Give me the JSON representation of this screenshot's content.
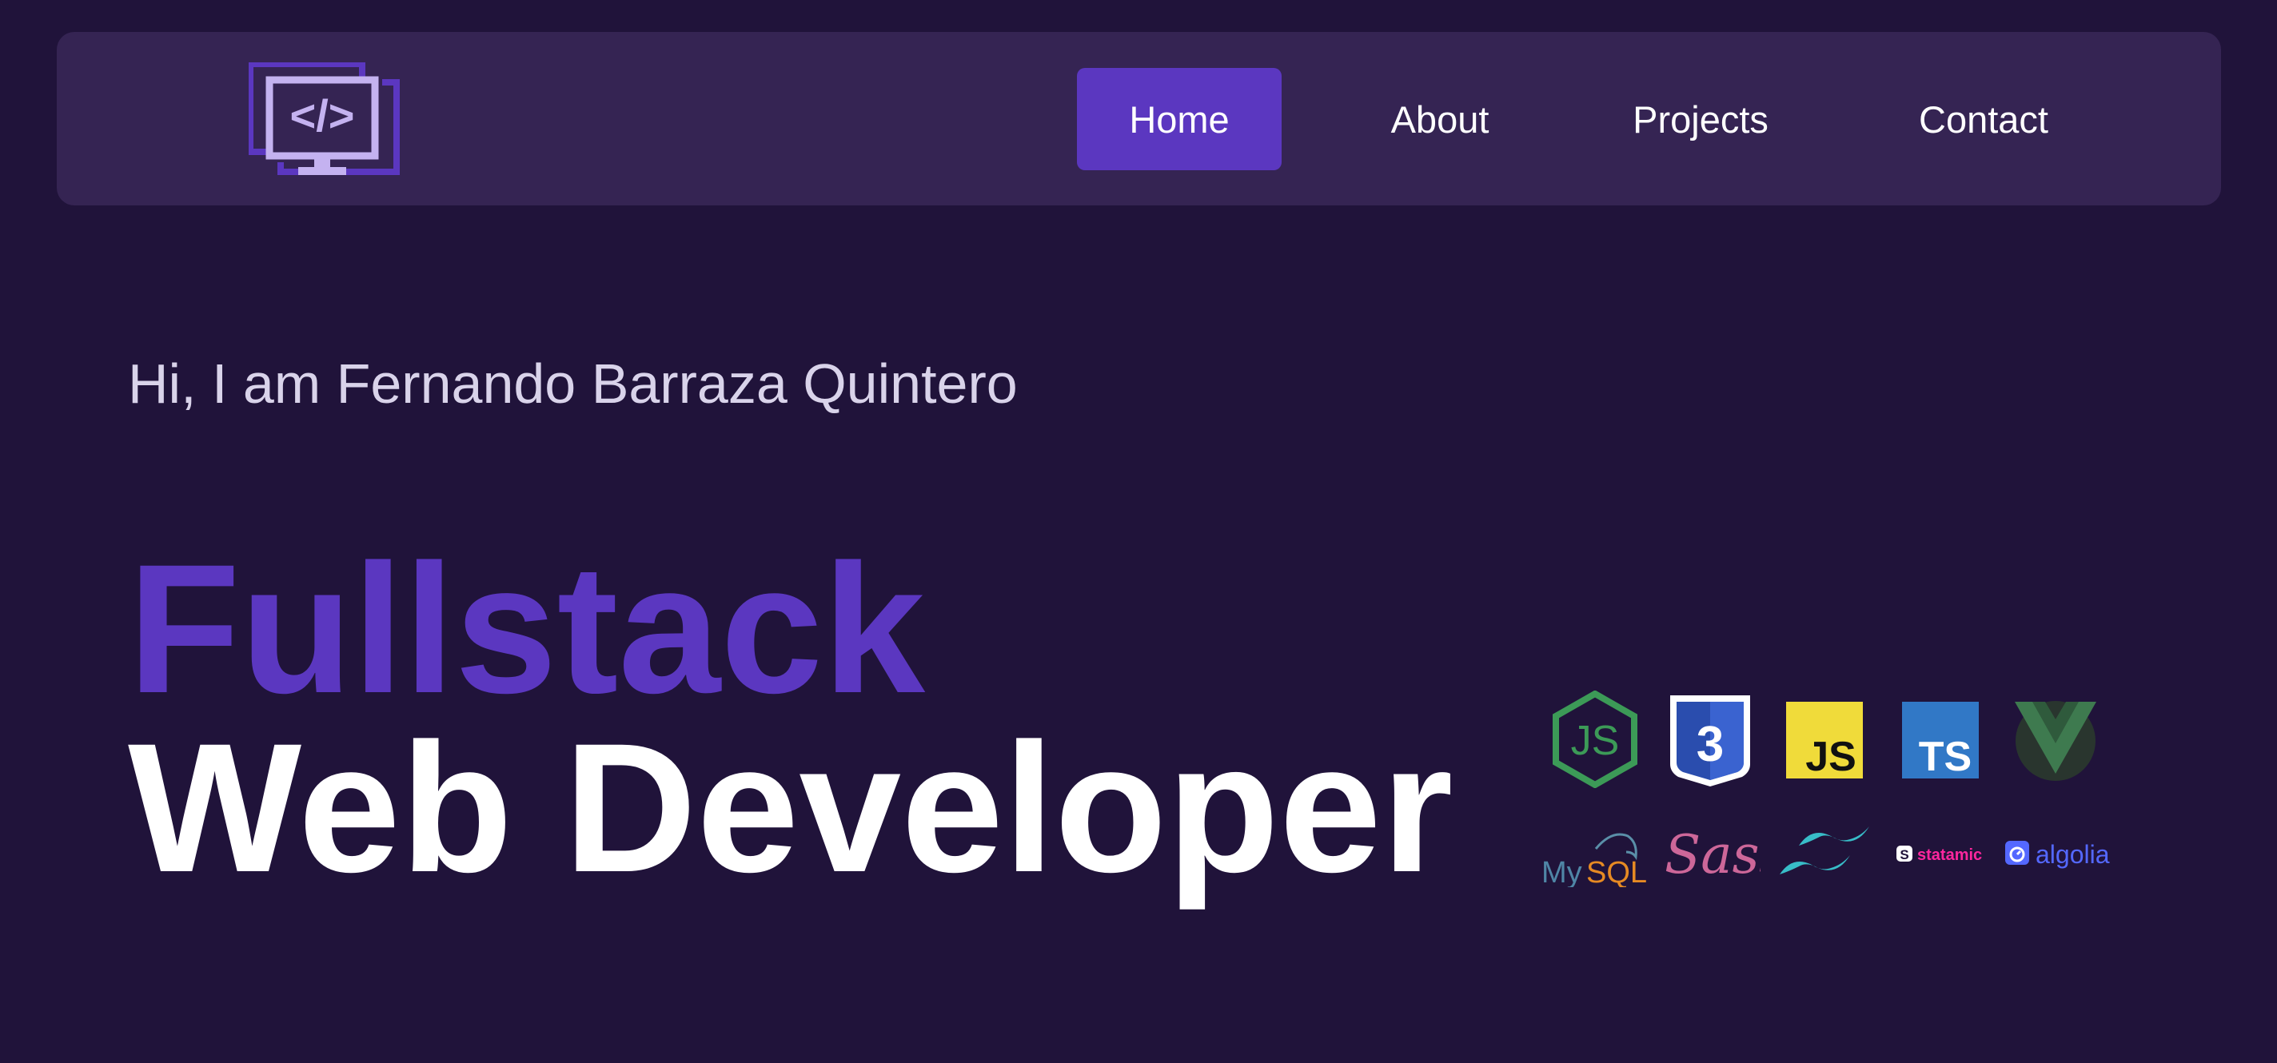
{
  "nav": {
    "logo_icon": "monitor-code-icon",
    "items": [
      {
        "label": "Home",
        "active": true
      },
      {
        "label": "About",
        "active": false
      },
      {
        "label": "Projects",
        "active": false
      },
      {
        "label": "Contact",
        "active": false
      }
    ]
  },
  "hero": {
    "greeting": "Hi, I am Fernando Barraza Quintero",
    "title_line1": "Fullstack",
    "title_line2": "Web Developer"
  },
  "tech": {
    "row1": [
      "nodejs-icon",
      "css3-icon",
      "javascript-icon",
      "typescript-icon",
      "vue-icon"
    ],
    "row2": [
      "mysql-icon",
      "sass-icon",
      "tailwind-icon",
      "statamic-icon",
      "algolia-icon"
    ],
    "labels": {
      "js": "JS",
      "ts": "TS",
      "css_num": "3",
      "mysql_my": "My",
      "mysql_sql": "SQL",
      "sass": "Sass",
      "statamic": "statamic",
      "algolia": "algolia"
    }
  },
  "colors": {
    "background": "#20133a",
    "navbar": "#352453",
    "accent": "#5b37c0",
    "text": "#ffffff"
  }
}
